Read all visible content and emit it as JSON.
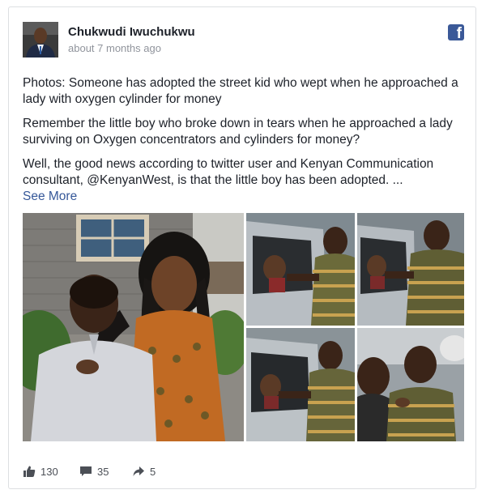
{
  "post": {
    "author": "Chukwudi Iwuchukwu",
    "timestamp": "about 7 months ago",
    "paragraphs": [
      "Photos: Someone has adopted the street kid who wept when he approached a lady with oxygen cylinder for money",
      "Remember the little boy who broke down in tears when he approached a lady surviving on Oxygen concentrators and cylinders for money?",
      "Well, the good news according to twitter user and Kenyan Communication consultant, @KenyanWest, is that the little boy has been adopted. ..."
    ],
    "see_more": "See More"
  },
  "footer": {
    "likes": "130",
    "comments": "35",
    "shares": "5"
  },
  "icons": {
    "brand": "facebook-icon",
    "like": "thumbs-up-icon",
    "comment": "comment-icon",
    "share": "share-arrow-icon"
  },
  "colors": {
    "facebook_blue": "#3b5998",
    "link": "#365899",
    "meta_text": "#90949c"
  }
}
